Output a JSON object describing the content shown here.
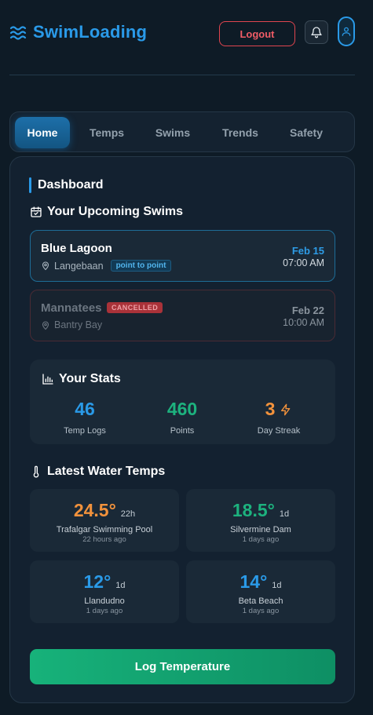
{
  "header": {
    "logo_text": "SwimLoading",
    "logout_label": "Logout",
    "accent_color": "#2a9ae8"
  },
  "tabs": [
    {
      "label": "Home",
      "active": true
    },
    {
      "label": "Temps",
      "active": false
    },
    {
      "label": "Swims",
      "active": false
    },
    {
      "label": "Trends",
      "active": false
    },
    {
      "label": "Safety",
      "active": false
    }
  ],
  "dashboard": {
    "title": "Dashboard",
    "upcoming": {
      "title": "Your Upcoming Swims",
      "icon": "calendar-check-icon",
      "swims": [
        {
          "name": "Blue Lagoon",
          "location": "Langebaan",
          "tag": "point to point",
          "date": "Feb 15",
          "time": "07:00 AM",
          "status": "active"
        },
        {
          "name": "Mannatees",
          "location": "Bantry Bay",
          "tag": "CANCELLED",
          "date": "Feb 22",
          "time": "10:00 AM",
          "status": "cancelled"
        }
      ]
    },
    "stats": {
      "title": "Your Stats",
      "icon": "bar-chart-icon",
      "items": [
        {
          "value": "46",
          "label": "Temp Logs",
          "color": "#2a9ae8"
        },
        {
          "value": "460",
          "label": "Points",
          "color": "#1db27e"
        },
        {
          "value": "3",
          "label": "Day Streak",
          "color": "#f2923c",
          "icon": "lightning-icon"
        }
      ]
    },
    "temps": {
      "title": "Latest Water Temps",
      "icon": "thermometer-icon",
      "items": [
        {
          "value": "24.5°",
          "ago_short": "22h",
          "name": "Trafalgar Swimming Pool",
          "ago": "22 hours ago",
          "color": "#f2923c"
        },
        {
          "value": "18.5°",
          "ago_short": "1d",
          "name": "Silvermine Dam",
          "ago": "1 days ago",
          "color": "#1db27e"
        },
        {
          "value": "12°",
          "ago_short": "1d",
          "name": "Llandudno",
          "ago": "1 days ago",
          "color": "#2a9ae8"
        },
        {
          "value": "14°",
          "ago_short": "1d",
          "name": "Beta Beach",
          "ago": "1 days ago",
          "color": "#2a9ae8"
        }
      ]
    },
    "log_button_label": "Log Temperature"
  }
}
